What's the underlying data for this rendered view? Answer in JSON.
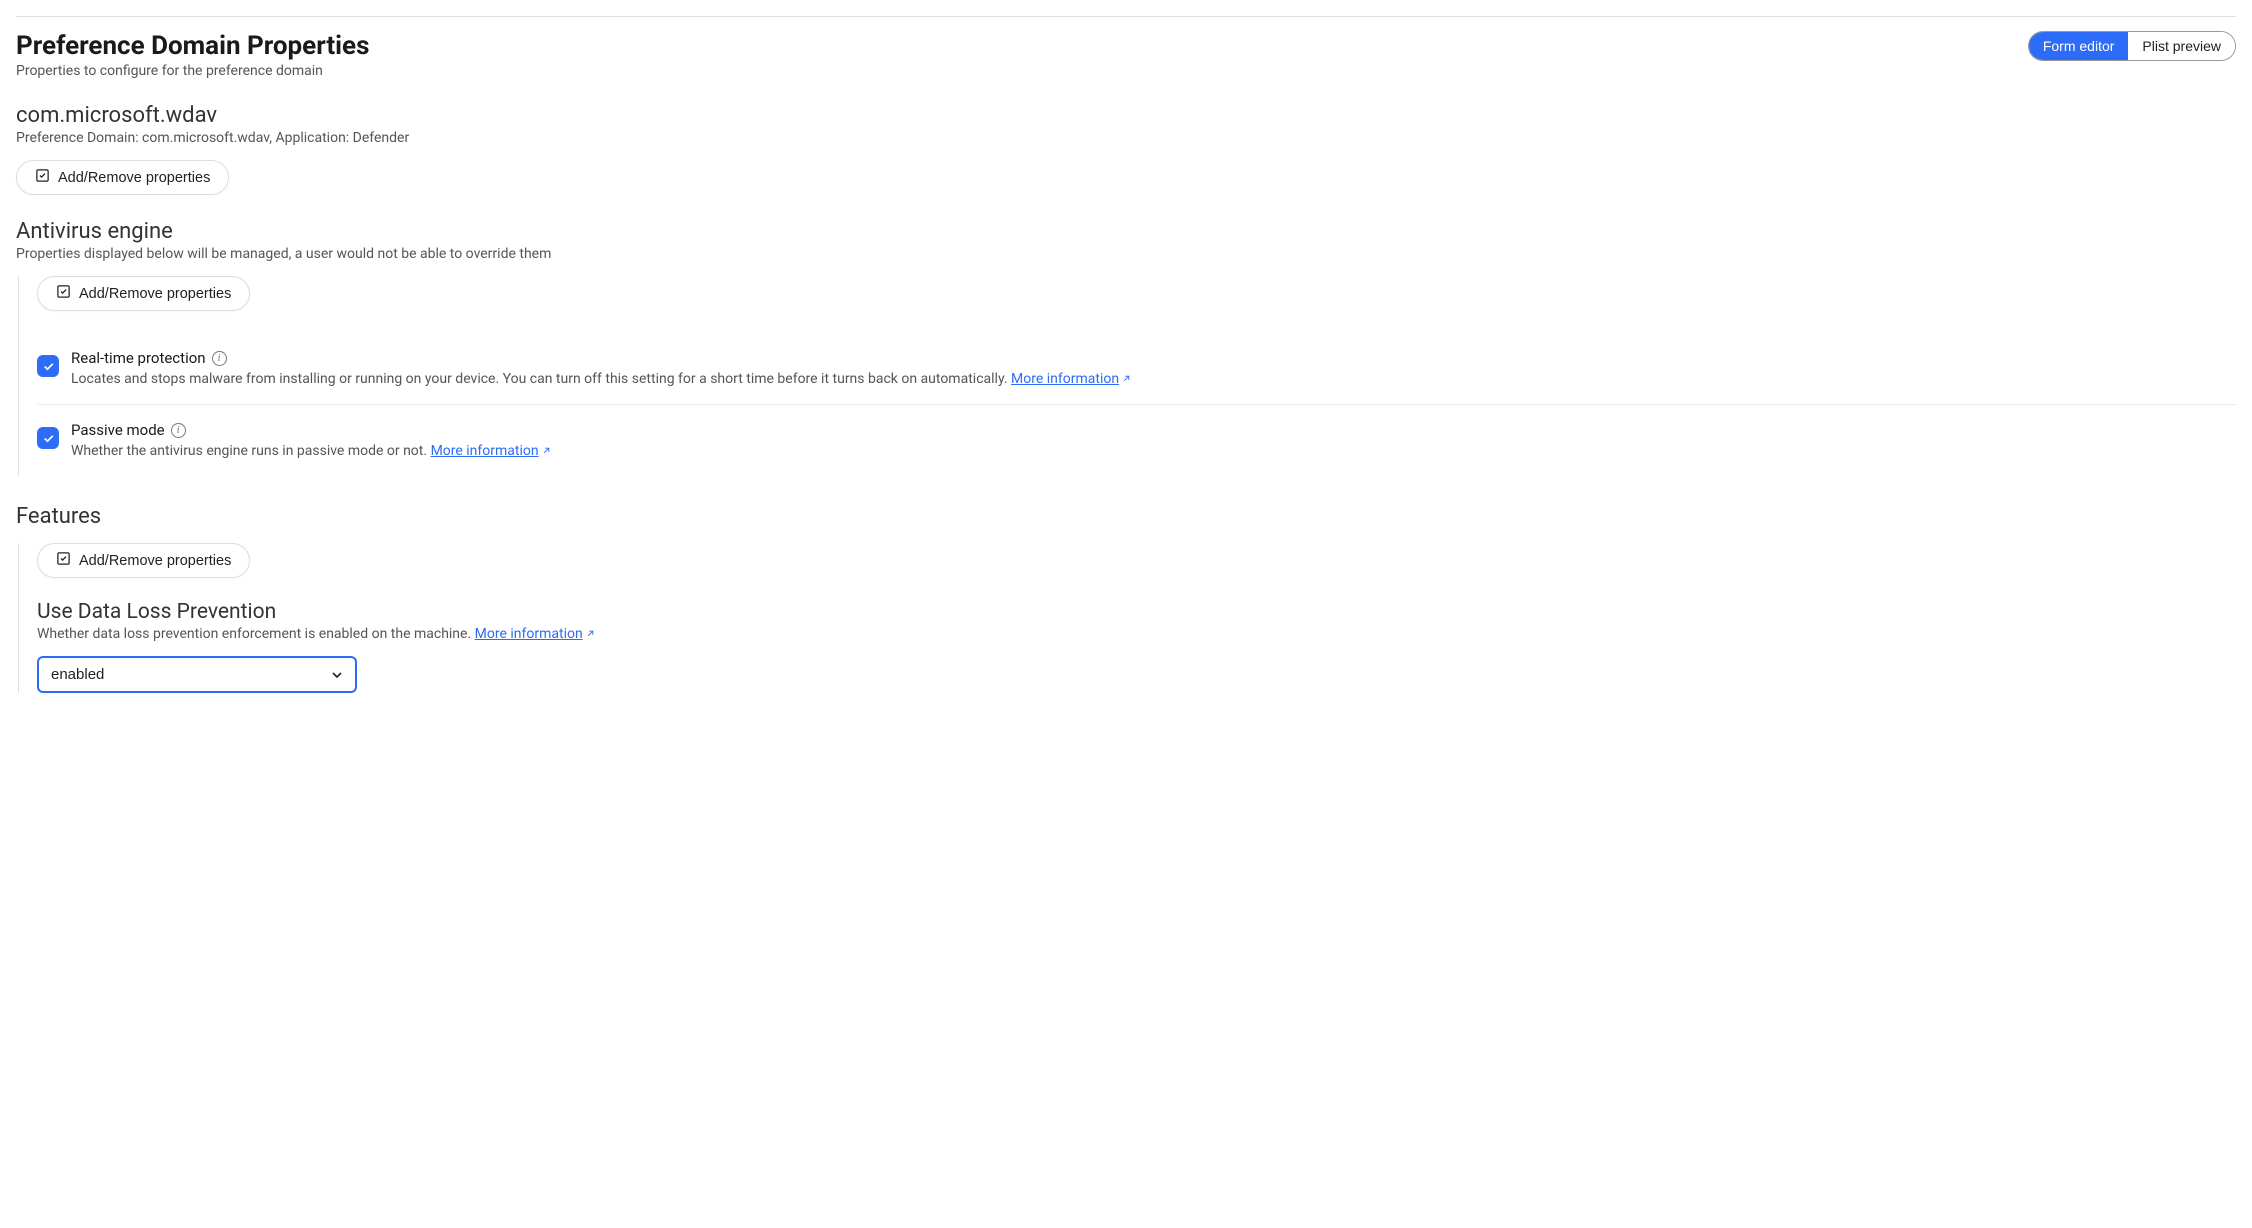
{
  "header": {
    "title": "Preference Domain Properties",
    "subtitle": "Properties to configure for the preference domain"
  },
  "toggle": {
    "form_editor": "Form editor",
    "plist_preview": "Plist preview"
  },
  "domain": {
    "name": "com.microsoft.wdav",
    "meta": "Preference Domain: com.microsoft.wdav, Application: Defender",
    "add_remove": "Add/Remove properties"
  },
  "antivirus": {
    "title": "Antivirus engine",
    "subtitle": "Properties displayed below will be managed, a user would not be able to override them",
    "add_remove": "Add/Remove properties",
    "realtime": {
      "title": "Real-time protection",
      "desc": "Locates and stops malware from installing or running on your device. You can turn off this setting for a short time before it turns back on automatically.",
      "link": "More information"
    },
    "passive": {
      "title": "Passive mode",
      "desc": "Whether the antivirus engine runs in passive mode or not.",
      "link": "More information"
    }
  },
  "features": {
    "title": "Features",
    "add_remove": "Add/Remove properties",
    "dlp": {
      "title": "Use Data Loss Prevention",
      "desc": "Whether data loss prevention enforcement is enabled on the machine.",
      "link": "More information",
      "value": "enabled"
    }
  }
}
